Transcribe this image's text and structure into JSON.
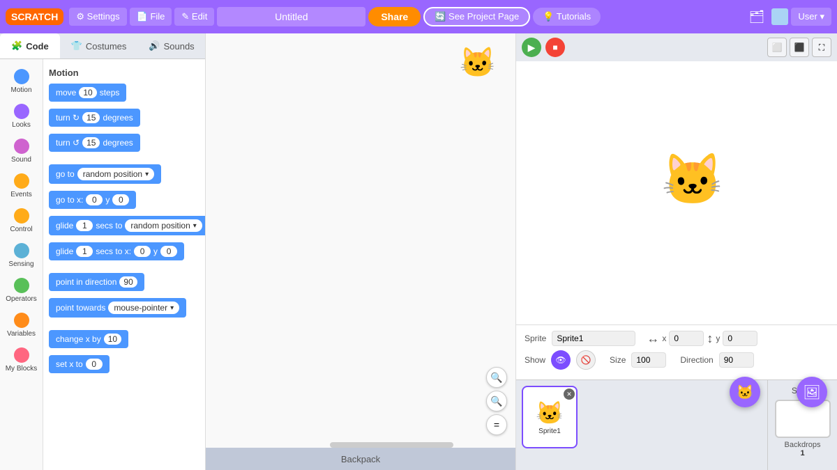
{
  "topbar": {
    "logo": "SCRATCH",
    "settings_label": "⚙ Settings",
    "file_label": "📄 File",
    "edit_label": "✎ Edit",
    "project_title": "Untitled",
    "share_label": "Share",
    "see_project_label": "🔄 See Project Page",
    "tutorials_label": "💡 Tutorials",
    "user_label": "User ▾"
  },
  "tabs": {
    "code": "Code",
    "costumes": "Costumes",
    "sounds": "Sounds"
  },
  "categories": [
    {
      "id": "motion",
      "label": "Motion",
      "color": "#4c97ff"
    },
    {
      "id": "looks",
      "label": "Looks",
      "color": "#9966ff"
    },
    {
      "id": "sound",
      "label": "Sound",
      "color": "#cf63cf"
    },
    {
      "id": "events",
      "label": "Events",
      "color": "#ffab19"
    },
    {
      "id": "control",
      "label": "Control",
      "color": "#ffab19"
    },
    {
      "id": "sensing",
      "label": "Sensing",
      "color": "#5cb1d6"
    },
    {
      "id": "operators",
      "label": "Operators",
      "color": "#59c059"
    },
    {
      "id": "variables",
      "label": "Variables",
      "color": "#ff8c1a"
    },
    {
      "id": "myblocks",
      "label": "My Blocks",
      "color": "#ff6680"
    }
  ],
  "blocks_title": "Motion",
  "blocks": [
    {
      "id": "move",
      "text": "move",
      "value": "10",
      "suffix": "steps"
    },
    {
      "id": "turn_cw",
      "text": "turn ↻",
      "value": "15",
      "suffix": "degrees"
    },
    {
      "id": "turn_ccw",
      "text": "turn ↺",
      "value": "15",
      "suffix": "degrees"
    },
    {
      "id": "goto",
      "text": "go to",
      "dropdown": "random position"
    },
    {
      "id": "goto_xy",
      "text": "go to x:",
      "x": "0",
      "y": "0"
    },
    {
      "id": "glide_to",
      "text": "glide",
      "value": "1",
      "suffix": "secs to",
      "dropdown": "random position"
    },
    {
      "id": "glide_xy",
      "text": "glide",
      "value": "1",
      "suffix": "secs to x:",
      "x": "0",
      "y": "0"
    },
    {
      "id": "point_dir",
      "text": "point in direction",
      "value": "90"
    },
    {
      "id": "point_towards",
      "text": "point towards",
      "dropdown": "mouse-pointer"
    },
    {
      "id": "change_x",
      "text": "change x by",
      "value": "10"
    },
    {
      "id": "set_x",
      "text": "set x to",
      "value": "0"
    }
  ],
  "script_area": {
    "backpack_label": "Backpack"
  },
  "stage": {
    "label": "Stage",
    "backdrops_label": "Backdrops",
    "backdrops_count": "1"
  },
  "sprite_info": {
    "sprite_label": "Sprite",
    "sprite_name": "Sprite1",
    "x_label": "x",
    "x_value": "0",
    "y_label": "y",
    "y_value": "0",
    "show_label": "Show",
    "size_label": "Size",
    "size_value": "100",
    "direction_label": "Direction",
    "direction_value": "90"
  },
  "sprite_list": [
    {
      "name": "Sprite1",
      "emoji": "🐱"
    }
  ],
  "zoom": {
    "in": "+",
    "out": "−",
    "fit": "="
  }
}
